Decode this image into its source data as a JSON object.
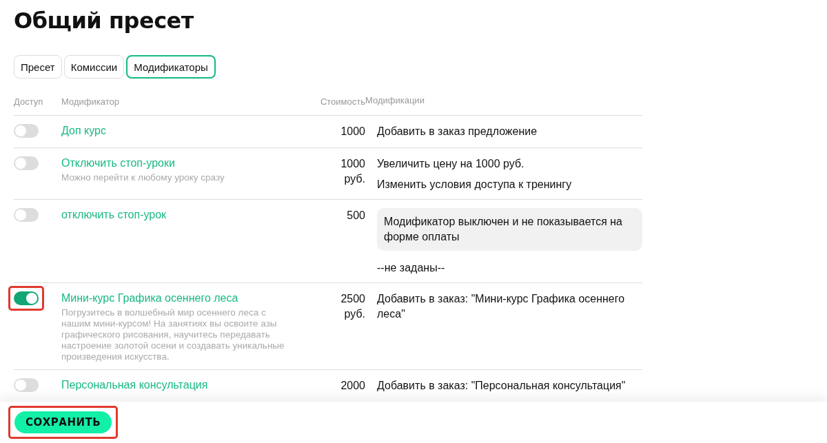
{
  "title": "Общий пресет",
  "tabs": [
    {
      "label": "Пресет",
      "selected": false
    },
    {
      "label": "Комиссии",
      "selected": false
    },
    {
      "label": "Модификаторы",
      "selected": true
    }
  ],
  "table": {
    "columns": [
      "Доступ",
      "Модификатор",
      "Стоимость",
      "Модификации"
    ],
    "rows": [
      {
        "enabled": false,
        "highlighted": false,
        "name": "Доп курс",
        "cost": "1000",
        "modifications": [
          {
            "kind": "text",
            "text": "Добавить в заказ предложение"
          }
        ]
      },
      {
        "enabled": false,
        "highlighted": false,
        "name": "Отключить стоп-уроки",
        "description": "Можно перейти к любому уроку сразу",
        "cost": "1000 руб.",
        "modifications": [
          {
            "kind": "text",
            "text": "Увеличить цену на 1000 руб."
          },
          {
            "kind": "text",
            "text": "Изменить условия доступа к тренингу"
          }
        ]
      },
      {
        "enabled": false,
        "highlighted": false,
        "name": "отключить стоп-урок",
        "cost": "500",
        "modifications": [
          {
            "kind": "notice",
            "text": "Модификатор выключен и не показывается на форме оплаты"
          },
          {
            "kind": "text",
            "text": "--не заданы--"
          }
        ]
      },
      {
        "enabled": true,
        "highlighted": true,
        "name": "Мини-курс Графика осеннего леса",
        "description": "Погрузитесь в волшебный мир осеннего леса с нашим мини-курсом! На занятиях вы освоите азы графического рисования, научитесь передавать настроение золотой осени и создавать уникальные произведения искусства.",
        "cost": "2500 руб.",
        "modifications": [
          {
            "kind": "text",
            "text": "Добавить в заказ: \"Мини-курс Графика осеннего леса\""
          }
        ]
      },
      {
        "enabled": false,
        "highlighted": false,
        "name": "Персональная консультация",
        "cost": "2000",
        "modifications": [
          {
            "kind": "text",
            "text": "Добавить в заказ: \"Персональная консультация\""
          }
        ]
      }
    ]
  },
  "save_button": {
    "label": "СОХРАНИТЬ",
    "highlighted": true
  }
}
